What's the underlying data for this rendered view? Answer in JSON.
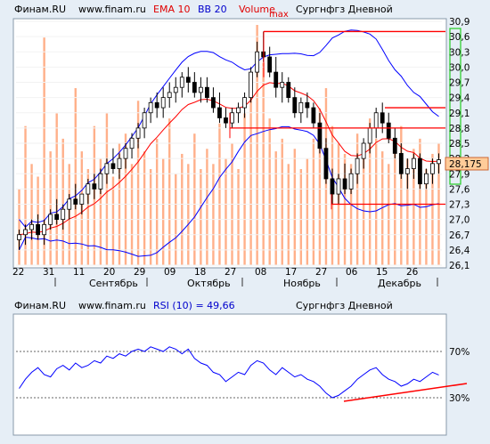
{
  "header": {
    "site": "Финам.RU",
    "url": "www.finam.ru",
    "ema": "EMA 10",
    "bb": "BB 20",
    "volume": "Volume",
    "max": "max",
    "title": "Сургнфгз Дневной"
  },
  "rsi_header": {
    "site": "Финам.RU",
    "url": "www.finam.ru",
    "indicator": "RSI (10) = 49,66",
    "title": "Сургнфгз Дневной"
  },
  "price_axis": [
    "30,9",
    "30,6",
    "30,3",
    "30,0",
    "29,7",
    "29,4",
    "29,1",
    "28,8",
    "28,5",
    "28,2",
    "27,9",
    "27,6",
    "27,3",
    "27,0",
    "26,7",
    "26,4",
    "26,1"
  ],
  "last_price": "28,175",
  "day_ticks": [
    "22",
    "31",
    "11",
    "20",
    "29",
    "09",
    "18",
    "27",
    "08",
    "17",
    "27",
    "06",
    "15",
    "26"
  ],
  "months": [
    "Сентябрь",
    "Октябрь",
    "Ноябрь",
    "Декабрь"
  ],
  "rsi_axis": [
    "70%",
    "30%"
  ],
  "colors": {
    "background": "#ffffff",
    "candle": "#000000",
    "ema": "#ff0000",
    "bollinger": "#0000ff",
    "volume": "#ffb08a",
    "level_line": "#ff0000",
    "green_marker": "#22cc22",
    "price_tag": "#ffcc99"
  },
  "chart_data": [
    {
      "type": "candlestick",
      "title": "Сургнфгз Дневной",
      "ylim": [
        26.1,
        30.9
      ],
      "x_tick_labels": [
        "22",
        "31",
        "11",
        "20",
        "29",
        "09",
        "18",
        "27",
        "08",
        "17",
        "27",
        "06",
        "15",
        "26"
      ],
      "month_labels": [
        "Сентябрь",
        "Октябрь",
        "Ноябрь",
        "Декабрь"
      ],
      "last_value": 28.175,
      "ohlc": [
        [
          26.6,
          26.8,
          26.4,
          26.7
        ],
        [
          26.7,
          26.9,
          26.5,
          26.8
        ],
        [
          26.8,
          27.0,
          26.6,
          26.9
        ],
        [
          26.9,
          27.1,
          26.6,
          26.7
        ],
        [
          26.7,
          27.0,
          26.5,
          26.9
        ],
        [
          26.9,
          27.2,
          26.8,
          27.1
        ],
        [
          27.1,
          27.4,
          26.9,
          27.0
        ],
        [
          27.0,
          27.3,
          26.8,
          27.2
        ],
        [
          27.2,
          27.5,
          27.0,
          27.4
        ],
        [
          27.4,
          27.7,
          27.2,
          27.3
        ],
        [
          27.3,
          27.5,
          27.1,
          27.5
        ],
        [
          27.5,
          27.8,
          27.3,
          27.7
        ],
        [
          27.7,
          27.9,
          27.4,
          27.6
        ],
        [
          27.6,
          28.0,
          27.5,
          27.9
        ],
        [
          27.9,
          28.2,
          27.7,
          28.1
        ],
        [
          28.1,
          28.4,
          27.9,
          28.0
        ],
        [
          28.0,
          28.3,
          27.8,
          28.2
        ],
        [
          28.2,
          28.5,
          28.0,
          28.4
        ],
        [
          28.4,
          28.7,
          28.2,
          28.6
        ],
        [
          28.6,
          28.9,
          28.4,
          28.8
        ],
        [
          28.8,
          29.2,
          28.6,
          29.1
        ],
        [
          29.1,
          29.4,
          28.9,
          29.3
        ],
        [
          29.3,
          29.5,
          29.0,
          29.2
        ],
        [
          29.2,
          29.6,
          29.0,
          29.4
        ],
        [
          29.4,
          29.7,
          29.2,
          29.5
        ],
        [
          29.5,
          29.8,
          29.3,
          29.6
        ],
        [
          29.6,
          29.9,
          29.4,
          29.8
        ],
        [
          29.8,
          30.0,
          29.5,
          29.7
        ],
        [
          29.7,
          29.9,
          29.4,
          29.5
        ],
        [
          29.5,
          29.8,
          29.3,
          29.6
        ],
        [
          29.6,
          29.8,
          29.3,
          29.4
        ],
        [
          29.4,
          29.6,
          29.1,
          29.2
        ],
        [
          29.2,
          29.5,
          28.9,
          29.0
        ],
        [
          29.0,
          29.2,
          28.8,
          28.9
        ],
        [
          28.9,
          29.2,
          28.8,
          29.1
        ],
        [
          29.1,
          29.3,
          28.9,
          29.2
        ],
        [
          29.2,
          29.5,
          29.0,
          29.4
        ],
        [
          29.4,
          30.0,
          29.3,
          29.9
        ],
        [
          29.9,
          30.5,
          29.8,
          30.3
        ],
        [
          30.3,
          30.7,
          30.1,
          30.2
        ],
        [
          30.2,
          30.4,
          29.8,
          29.9
        ],
        [
          29.9,
          30.2,
          29.4,
          29.6
        ],
        [
          29.6,
          29.9,
          29.3,
          29.7
        ],
        [
          29.7,
          29.8,
          29.3,
          29.4
        ],
        [
          29.4,
          29.6,
          29.0,
          29.1
        ],
        [
          29.1,
          29.4,
          28.9,
          29.3
        ],
        [
          29.3,
          29.5,
          29.0,
          29.2
        ],
        [
          29.2,
          29.3,
          28.8,
          28.9
        ],
        [
          28.9,
          29.1,
          28.3,
          28.4
        ],
        [
          28.4,
          28.6,
          27.7,
          27.8
        ],
        [
          27.8,
          28.0,
          27.3,
          27.5
        ],
        [
          27.5,
          27.9,
          27.3,
          27.8
        ],
        [
          27.8,
          28.1,
          27.5,
          27.6
        ],
        [
          27.6,
          28.0,
          27.5,
          27.9
        ],
        [
          27.9,
          28.3,
          27.7,
          28.2
        ],
        [
          28.2,
          28.6,
          28.0,
          28.5
        ],
        [
          28.5,
          28.9,
          28.3,
          28.8
        ],
        [
          28.8,
          29.2,
          28.6,
          29.1
        ],
        [
          29.1,
          29.3,
          28.7,
          28.9
        ],
        [
          28.9,
          29.1,
          28.5,
          28.6
        ],
        [
          28.6,
          28.8,
          28.2,
          28.3
        ],
        [
          28.3,
          28.5,
          27.8,
          27.9
        ],
        [
          27.9,
          28.2,
          27.6,
          28.0
        ],
        [
          28.0,
          28.3,
          27.8,
          28.2
        ],
        [
          28.2,
          28.3,
          27.6,
          27.7
        ],
        [
          27.7,
          28.0,
          27.6,
          27.9
        ],
        [
          27.9,
          28.2,
          27.7,
          28.1
        ],
        [
          28.1,
          28.3,
          27.9,
          28.175
        ]
      ],
      "volume": [
        30,
        55,
        40,
        35,
        90,
        45,
        60,
        50,
        40,
        70,
        45,
        38,
        55,
        42,
        60,
        35,
        48,
        52,
        40,
        65,
        45,
        38,
        50,
        42,
        58,
        36,
        44,
        40,
        52,
        38,
        46,
        40,
        56,
        42,
        48,
        38,
        60,
        72,
        95,
        80,
        58,
        45,
        50,
        40,
        46,
        38,
        42,
        50,
        62,
        70,
        55,
        48,
        44,
        40,
        52,
        46,
        58,
        50,
        45,
        40,
        48,
        55,
        42,
        46,
        50,
        38,
        44,
        48
      ],
      "overlays": [
        "EMA 10",
        "BB 20"
      ],
      "level_lines": [
        30.7,
        29.2,
        28.8,
        27.3
      ]
    },
    {
      "type": "line",
      "title": "RSI (10) = 49,66",
      "ylim": [
        0,
        100
      ],
      "reference_levels": [
        70,
        30
      ],
      "last_value": 49.66,
      "values": [
        38,
        46,
        52,
        56,
        50,
        48,
        55,
        58,
        54,
        60,
        56,
        58,
        62,
        60,
        66,
        64,
        68,
        66,
        70,
        72,
        70,
        74,
        72,
        70,
        74,
        72,
        68,
        72,
        64,
        60,
        58,
        52,
        50,
        44,
        48,
        52,
        50,
        58,
        62,
        60,
        54,
        50,
        56,
        52,
        48,
        50,
        46,
        44,
        40,
        34,
        30,
        32,
        36,
        40,
        46,
        50,
        54,
        56,
        50,
        46,
        44,
        40,
        42,
        46,
        44,
        48,
        52,
        49.66
      ]
    }
  ]
}
